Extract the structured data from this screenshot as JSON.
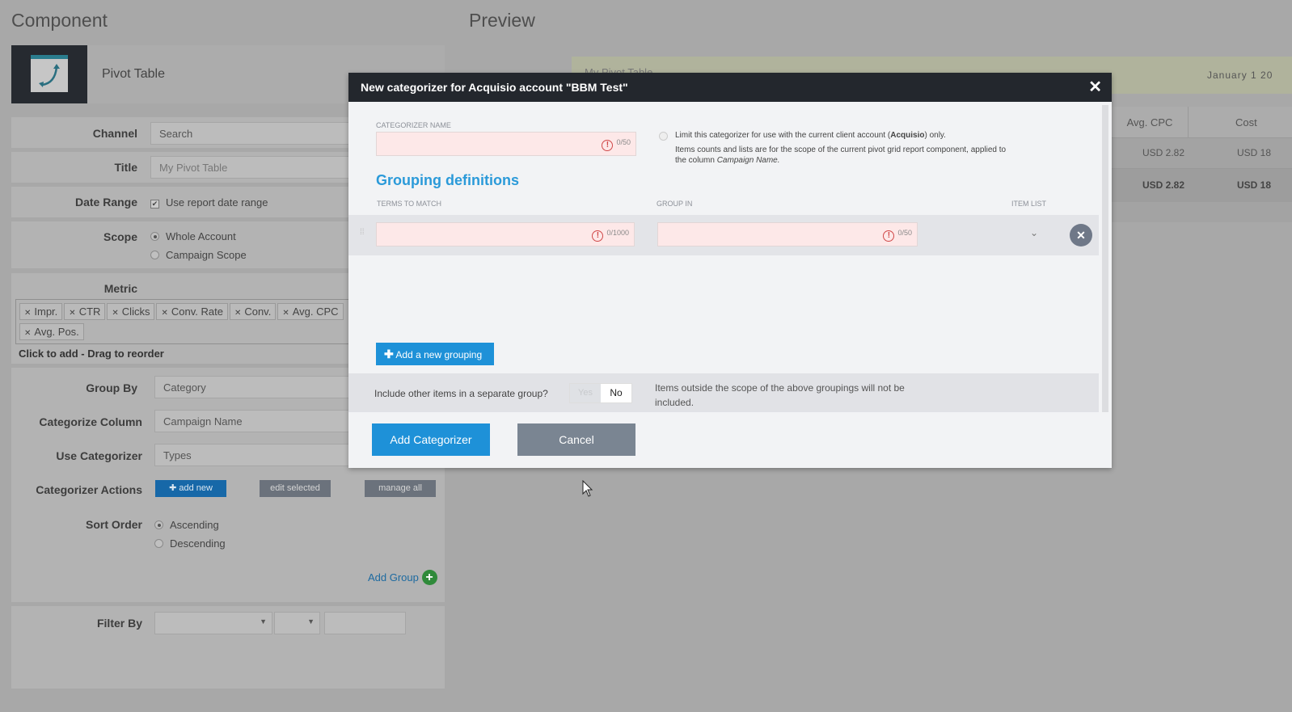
{
  "component": {
    "heading": "Component",
    "name": "Pivot Table",
    "fields": {
      "channel": {
        "label": "Channel",
        "value": "Search"
      },
      "title": {
        "label": "Title",
        "placeholder": "My Pivot Table"
      },
      "date_range": {
        "label": "Date Range",
        "option": "Use report date range",
        "checked": true
      },
      "scope": {
        "label": "Scope",
        "options": [
          "Whole Account",
          "Campaign Scope"
        ],
        "selected": "Whole Account"
      },
      "metric": {
        "label": "Metric",
        "tags": [
          "Impr.",
          "CTR",
          "Clicks",
          "Conv. Rate",
          "Conv.",
          "Avg. CPC",
          "Avg. Pos."
        ],
        "hint": "Click to add - Drag to reorder"
      },
      "group_by": {
        "label": "Group By",
        "value": "Category"
      },
      "categorize_column": {
        "label": "Categorize Column",
        "value": "Campaign Name"
      },
      "use_categorizer": {
        "label": "Use Categorizer",
        "value": "Types"
      },
      "actions": {
        "label": "Categorizer Actions",
        "add_new": "add new",
        "edit_selected": "edit selected",
        "manage_all": "manage all"
      },
      "sort_order": {
        "label": "Sort Order",
        "options": [
          "Ascending",
          "Descending"
        ],
        "selected": "Ascending"
      },
      "add_group": "Add Group",
      "filter_by": {
        "label": "Filter By"
      }
    }
  },
  "preview": {
    "heading": "Preview",
    "table_title": "My Pivot Table",
    "date": "January 1 20",
    "columns": [
      "Avg. CPC",
      "Cost"
    ],
    "rows": [
      [
        "USD 2.82",
        "USD 18"
      ],
      [
        "USD 2.82",
        "USD 18"
      ]
    ]
  },
  "modal": {
    "title": "New categorizer for Acquisio account \"BBM Test\"",
    "name_label": "CATEGORIZER NAME",
    "name_count": "0/50",
    "limit_text_pre": "Limit this categorizer for use with the current client account (",
    "limit_account": "Acquisio",
    "limit_text_post": ") only.",
    "scope_text": "Items counts and lists are for the scope of the current pivot grid report component, applied to the column ",
    "scope_column": "Campaign Name.",
    "grouping_heading": "Grouping definitions",
    "col_terms": "TERMS TO MATCH",
    "col_group": "GROUP IN",
    "col_items": "ITEM LIST",
    "terms_count": "0/1000",
    "group_count": "0/50",
    "add_grouping": "Add a new grouping",
    "include_question": "Include other items in a separate group?",
    "yes": "Yes",
    "no": "No",
    "toggle_selected": "No",
    "include_note": "Items outside the scope of the above groupings will not be included.",
    "submit": "Add Categorizer",
    "cancel": "Cancel"
  },
  "colors": {
    "accent": "#1e91d8",
    "header": "#23272d",
    "error_field": "#fde8e8",
    "add_group": "#2f8a3a"
  }
}
